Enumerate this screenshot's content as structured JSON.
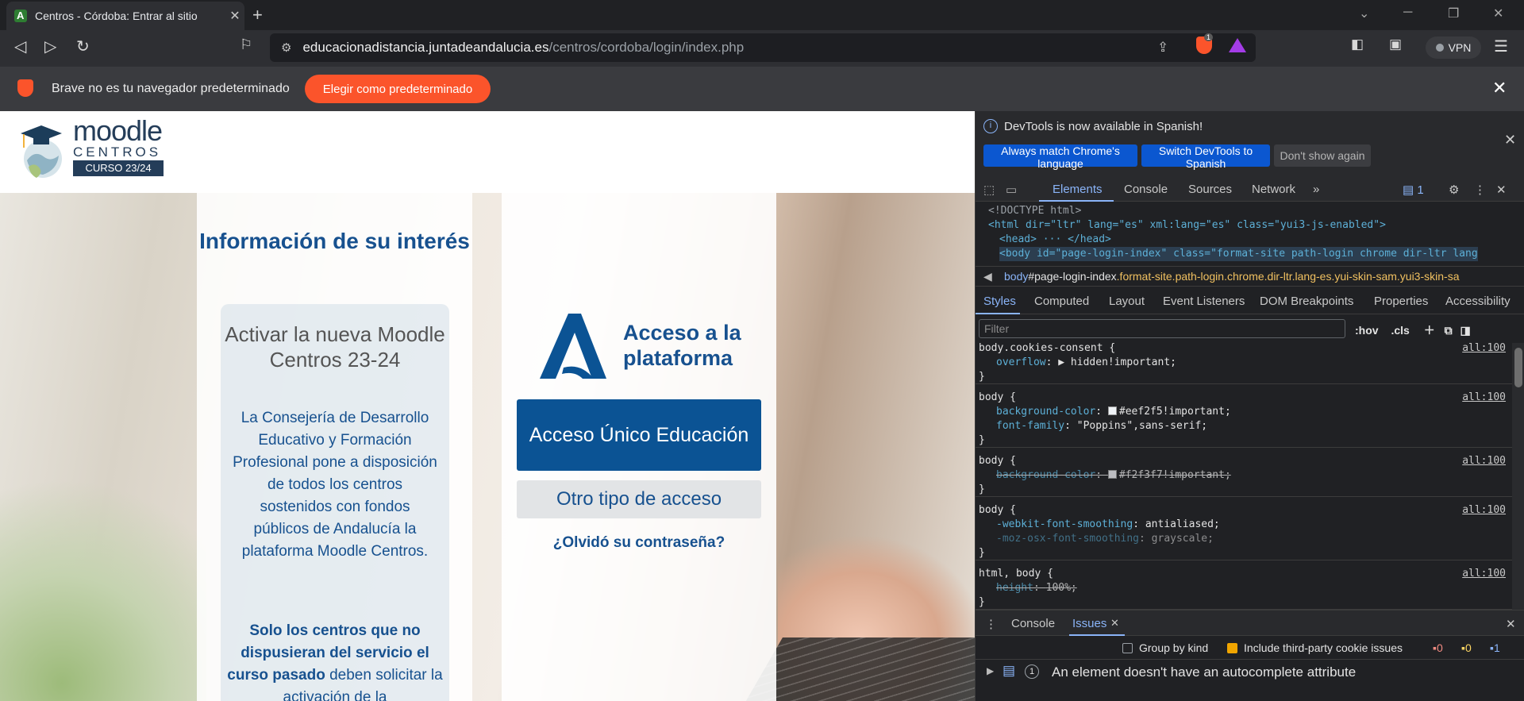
{
  "browser": {
    "tab_title": "Centros - Córdoba: Entrar al sitio",
    "url_host": "educacionadistancia.juntadeandalucia.es",
    "url_path": "/centros/cordoba/login/index.php",
    "shield_count": "1",
    "vpn_label": "VPN",
    "infobar_message": "Brave no es tu navegador predeterminado",
    "infobar_button": "Elegir como predeterminado"
  },
  "page": {
    "logo_text": "moodle",
    "logo_sub": "CENTROS",
    "logo_course": "CURSO 23/24",
    "info_title": "Información de su interés",
    "card_title": "Activar la nueva Moodle Centros 23-24",
    "card_body": "La Consejería de Desarrollo Educativo y Formación Profesional pone a disposición de todos los centros sostenidos con fondos públicos de Andalucía la plataforma Moodle Centros.",
    "card_body2_bold": "Solo los centros que no dispusieran del servicio el curso pasado",
    "card_body2_rest": " deben solicitar la activación de la",
    "access_title": "Acceso a la plataforma",
    "btn_main": "Acceso Único Educación",
    "btn_other": "Otro tipo de acceso",
    "forgot": "¿Olvidó su contraseña?"
  },
  "devtools": {
    "notice": "DevTools is now available in Spanish!",
    "btn_match": "Always match Chrome's language",
    "btn_switch": "Switch DevTools to Spanish",
    "btn_dismiss": "Don't show again",
    "tabs": [
      "Elements",
      "Console",
      "Sources",
      "Network"
    ],
    "issues_badge": "1",
    "dom": {
      "doctype": "<!DOCTYPE html>",
      "html_open": "<html dir=\"ltr\" lang=\"es\" xml:lang=\"es\" class=\"yui3-js-enabled\">",
      "head": "<head> ··· </head>",
      "body": "<body id=\"page-login-index\" class=\"format-site path-login chrome dir-ltr lang"
    },
    "breadcrumb_tag": "body",
    "breadcrumb_id": "#page-login-index",
    "breadcrumb_class": ".format-site.path-login.chrome.dir-ltr.lang-es.yui-skin-sam.yui3-skin-sa",
    "style_tabs": [
      "Styles",
      "Computed",
      "Layout",
      "Event Listeners",
      "DOM Breakpoints",
      "Properties",
      "Accessibility"
    ],
    "filter_placeholder": "Filter",
    "hov": ":hov",
    "cls": ".cls",
    "rules": [
      {
        "selector": "body.cookies-consent {",
        "src": "all:100",
        "props": [
          {
            "name": "overflow",
            "value": "▶ hidden!important;",
            "strike": false
          }
        ]
      },
      {
        "selector": "body {",
        "src": "all:100",
        "props": [
          {
            "name": "background-color",
            "value": "#eef2f5!important;",
            "strike": false,
            "swatch": "#eef2f5"
          },
          {
            "name": "font-family",
            "value": "\"Poppins\",sans-serif;",
            "strike": false
          }
        ]
      },
      {
        "selector": "body {",
        "src": "all:100",
        "props": [
          {
            "name": "background-color",
            "value": "#f2f3f7!important;",
            "strike": true,
            "swatch": "#f2f3f7"
          }
        ]
      },
      {
        "selector": "body {",
        "src": "all:100",
        "props": [
          {
            "name": "-webkit-font-smoothing",
            "value": "antialiased;",
            "strike": false
          },
          {
            "name": "-moz-osx-font-smoothing",
            "value": "grayscale;",
            "strike": "dim"
          }
        ]
      },
      {
        "selector": "html, body {",
        "src": "all:100",
        "props": [
          {
            "name": "height",
            "value": "100%;",
            "strike": true
          }
        ]
      }
    ],
    "drawer_tabs": [
      "Console",
      "Issues"
    ],
    "group_by_kind": "Group by kind",
    "third_party": "Include third-party cookie issues",
    "counts": {
      "errors": "0",
      "warnings": "0",
      "info": "1"
    },
    "issue_count": "1",
    "issue_text": "An element doesn't have an autocomplete attribute"
  }
}
